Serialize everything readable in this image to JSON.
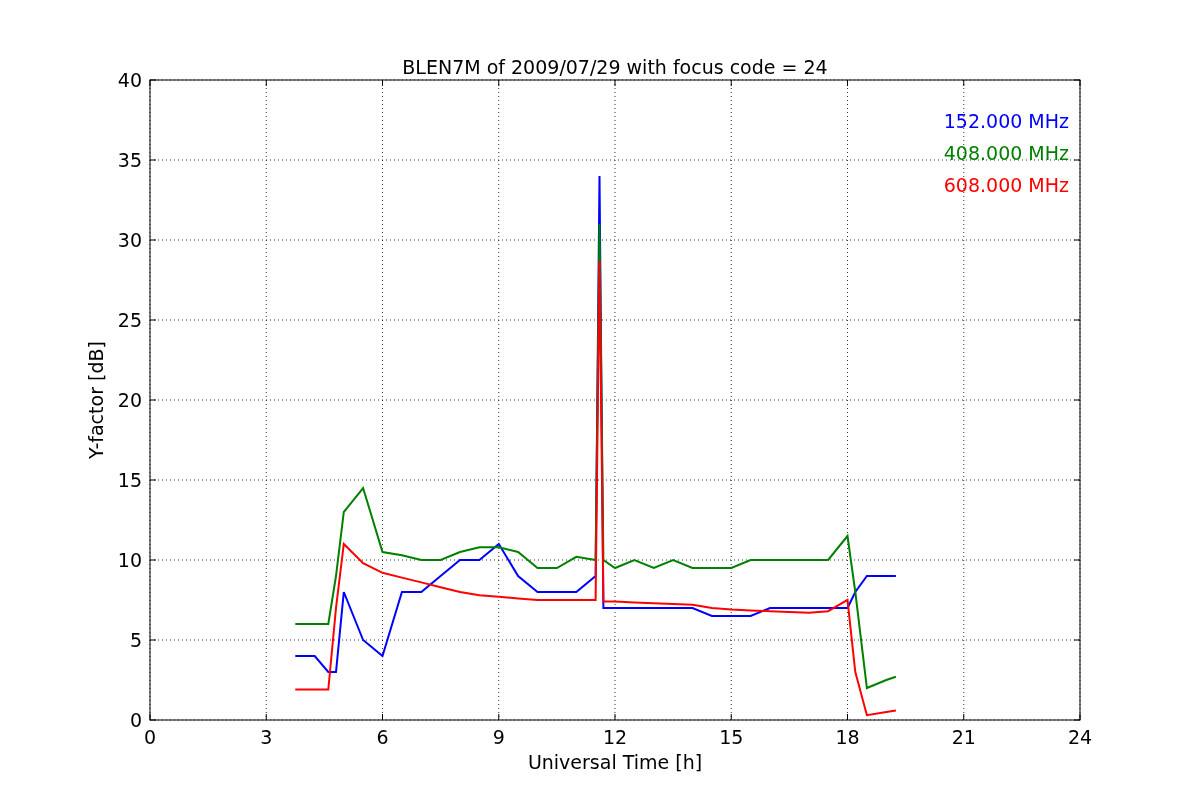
{
  "chart_data": {
    "type": "line",
    "title": "BLEN7M of 2009/07/29 with focus code = 24",
    "xlabel": "Universal Time [h]",
    "ylabel": "Y-factor [dB]",
    "x": [
      3.75,
      4.25,
      4.6,
      4.8,
      5,
      5.5,
      6,
      6.5,
      7,
      7.5,
      8,
      8.5,
      9,
      9.5,
      10,
      10.5,
      11,
      11.5,
      11.6,
      11.7,
      12,
      12.5,
      13,
      13.5,
      14,
      14.5,
      15,
      15.5,
      16,
      16.5,
      17,
      17.5,
      18,
      18.2,
      18.5,
      19,
      19.25
    ],
    "series": [
      {
        "name": "152.000 MHz",
        "color": "#0000ff",
        "values": [
          4,
          4,
          3,
          3,
          8,
          5,
          4,
          8,
          8,
          9,
          10,
          10,
          11,
          9,
          8,
          8,
          8,
          9,
          34,
          7,
          7,
          7,
          7,
          7,
          7,
          6.5,
          6.5,
          6.5,
          7,
          7,
          7,
          7,
          7,
          8,
          9,
          9,
          9
        ]
      },
      {
        "name": "408.000 MHz",
        "color": "#008000",
        "values": [
          6,
          6,
          6,
          9,
          13,
          14.5,
          10.5,
          10.3,
          10,
          10,
          10.5,
          10.8,
          10.8,
          10.5,
          9.5,
          9.5,
          10.2,
          10,
          31,
          10,
          9.5,
          10,
          9.5,
          10,
          9.5,
          9.5,
          9.5,
          10,
          10,
          10,
          10,
          10,
          11.5,
          8,
          2,
          2.5,
          2.7
        ]
      },
      {
        "name": "608.000 MHz",
        "color": "#ff0000",
        "values": [
          1.9,
          1.9,
          1.9,
          7,
          11,
          9.8,
          9.2,
          8.9,
          8.6,
          8.3,
          8,
          7.8,
          7.7,
          7.6,
          7.5,
          7.5,
          7.5,
          7.5,
          28.7,
          7.4,
          7.4,
          7.35,
          7.3,
          7.25,
          7.2,
          7.0,
          6.9,
          6.85,
          6.8,
          6.75,
          6.7,
          6.8,
          7.5,
          3,
          0.3,
          0.5,
          0.6
        ]
      }
    ],
    "grid": true,
    "xlim": [
      0,
      24
    ],
    "ylim": [
      0,
      40
    ],
    "xticks": [
      0,
      3,
      6,
      9,
      12,
      15,
      18,
      21,
      24
    ],
    "yticks": [
      0,
      5,
      10,
      15,
      20,
      25,
      30,
      35,
      40
    ]
  }
}
